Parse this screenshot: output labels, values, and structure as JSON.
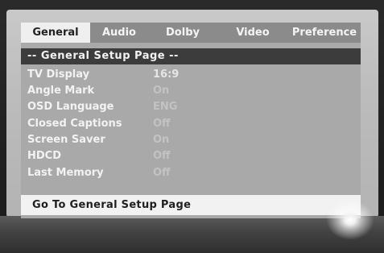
{
  "tabs": [
    {
      "label": "General",
      "active": true
    },
    {
      "label": "Audio",
      "active": false
    },
    {
      "label": "Dolby",
      "active": false
    },
    {
      "label": "Video",
      "active": false
    },
    {
      "label": "Preference",
      "active": false
    }
  ],
  "header": {
    "title": "-- General Setup Page --"
  },
  "settings": [
    {
      "label": "TV Display",
      "value": "16:9"
    },
    {
      "label": "Angle Mark",
      "value": "On"
    },
    {
      "label": "OSD Language",
      "value": "ENG"
    },
    {
      "label": "Closed Captions",
      "value": "Off"
    },
    {
      "label": "Screen Saver",
      "value": "On"
    },
    {
      "label": "HDCD",
      "value": "Off"
    },
    {
      "label": "Last Memory",
      "value": "Off"
    }
  ],
  "status": {
    "text": "Go To General Setup Page"
  },
  "colors": {
    "active_tab": "#efefef",
    "tab_bar": "#8b8b8b",
    "panel": "#a9a9a9",
    "header_bar": "#3c3c3c",
    "status_bar": "#f2f2f2"
  }
}
